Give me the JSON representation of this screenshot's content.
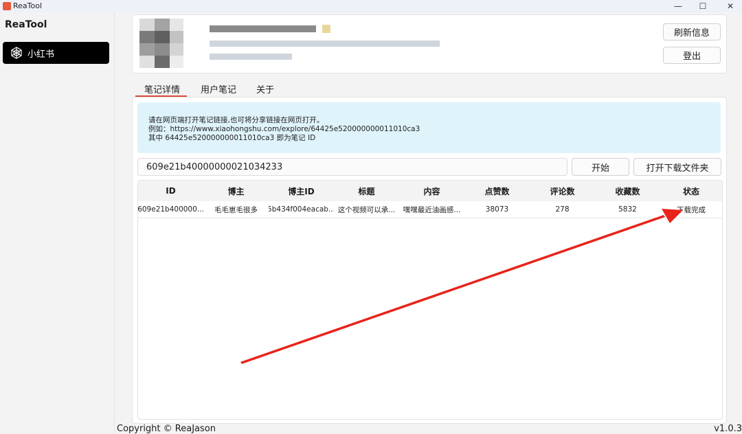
{
  "window": {
    "title": "ReaTool",
    "minimize": "—",
    "maximize": "☐",
    "close": "✕"
  },
  "sidebar": {
    "brand": "ReaTool",
    "items": [
      {
        "label": "小红书",
        "icon": "spiderweb-icon"
      }
    ]
  },
  "profile": {
    "refresh_label": "刷新信息",
    "logout_label": "登出"
  },
  "tabs": [
    {
      "label": "笔记详情"
    },
    {
      "label": "用户笔记"
    },
    {
      "label": "关于"
    }
  ],
  "notice": {
    "lines": [
      "请在网页端打开笔记链接,也可将分享链接在网页打开。",
      "例如：https://www.xiaohongshu.com/explore/64425e520000000011010ca3",
      "其中 64425e520000000011010ca3 即为笔记 ID"
    ]
  },
  "url_input": {
    "value": "609e21b40000000021034233"
  },
  "buttons": {
    "start": "开始",
    "open_folder": "打开下载文件夹"
  },
  "table": {
    "columns": [
      "ID",
      "博主",
      "博主ID",
      "标题",
      "内容",
      "点赞数",
      "评论数",
      "收藏数",
      "状态"
    ],
    "rows": [
      [
        "609e21b400000...",
        "毛毛崽毛很多",
        "5b434f004eacab...",
        "这个视频可以承...",
        "嘿嘿最近油画感...",
        "38073",
        "278",
        "5832",
        "下载完成"
      ]
    ]
  },
  "footer": {
    "copyright": "Copyright © ReaJason",
    "version": "v1.0.3"
  },
  "colors": {
    "accent": "#d94a3b",
    "arrow": "#e8231a",
    "notice_bg": "#dff3fb",
    "nav_active": "#000000"
  }
}
